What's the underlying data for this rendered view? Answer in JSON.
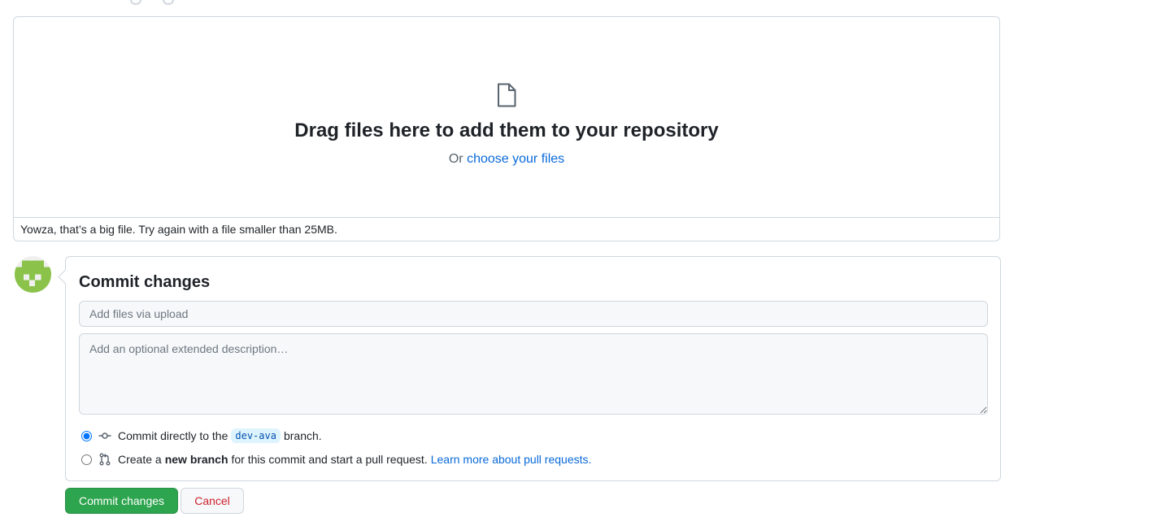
{
  "dropzone": {
    "title": "Drag files here to add them to your repository",
    "or_text": "Or",
    "choose_link": "choose your files",
    "error_message": "Yowza, that’s a big file. Try again with a file smaller than 25MB.",
    "icon": "file-icon"
  },
  "commit": {
    "heading": "Commit changes",
    "summary_placeholder": "Add files via upload",
    "description_placeholder": "Add an optional extended description…",
    "option_direct": {
      "prefix": "Commit directly to the",
      "branch": "dev-ava",
      "suffix": "branch.",
      "checked": true,
      "icon": "git-commit-icon"
    },
    "option_new_branch": {
      "prefix": "Create a",
      "bold": "new branch",
      "suffix": "for this commit and start a pull request.",
      "link": "Learn more about pull requests.",
      "checked": false,
      "icon": "git-pull-request-icon"
    }
  },
  "buttons": {
    "commit_label": "Commit changes",
    "cancel_label": "Cancel"
  },
  "colors": {
    "accent_link": "#0969da",
    "commit_button": "#2da44e",
    "cancel_text": "#cf222e",
    "avatar_green": "#8bc34a"
  }
}
